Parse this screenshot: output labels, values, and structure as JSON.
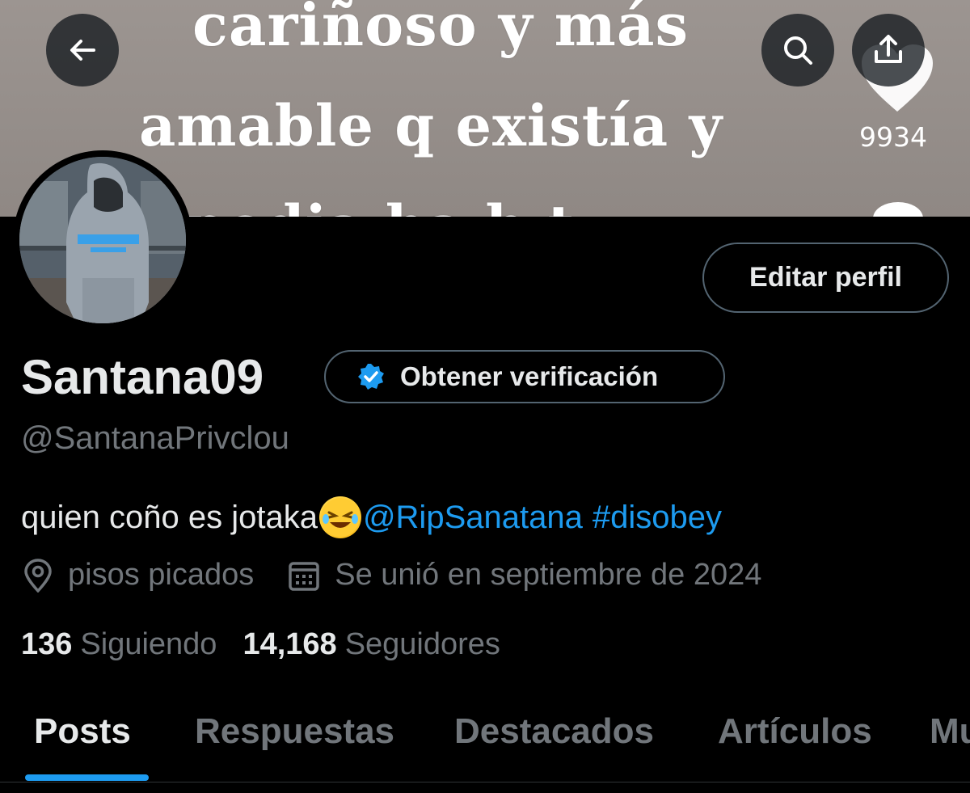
{
  "banner": {
    "line1": "cariñoso y más",
    "line2": "amable q existía y",
    "line3": "podia ha h  t",
    "like_count": "9934"
  },
  "header": {
    "back_icon": "arrow-left-icon",
    "search_icon": "search-icon",
    "share_icon": "share-upload-icon"
  },
  "profile": {
    "edit_label": "Editar perfil",
    "display_name": "Santana09",
    "verify_label": "Obtener verificación",
    "handle": "@SantanaPrivclou",
    "bio_text": "quien coño es jotaka",
    "bio_mention": "@RipSanatana",
    "bio_hashtag": "#disobey",
    "location": "pisos picados",
    "joined": "Se unió en septiembre de 2024",
    "following_count": "136",
    "following_label": "Siguiendo",
    "followers_count": "14,168",
    "followers_label": "Seguidores"
  },
  "tabs": [
    {
      "label": "Posts",
      "active": true
    },
    {
      "label": "Respuestas",
      "active": false
    },
    {
      "label": "Destacados",
      "active": false
    },
    {
      "label": "Artículos",
      "active": false
    },
    {
      "label": "Mu",
      "active": false
    }
  ],
  "colors": {
    "accent": "#1d9bf0",
    "background": "#000000",
    "text_primary": "#e7e9ea",
    "text_secondary": "#71767b",
    "border": "#536471"
  }
}
